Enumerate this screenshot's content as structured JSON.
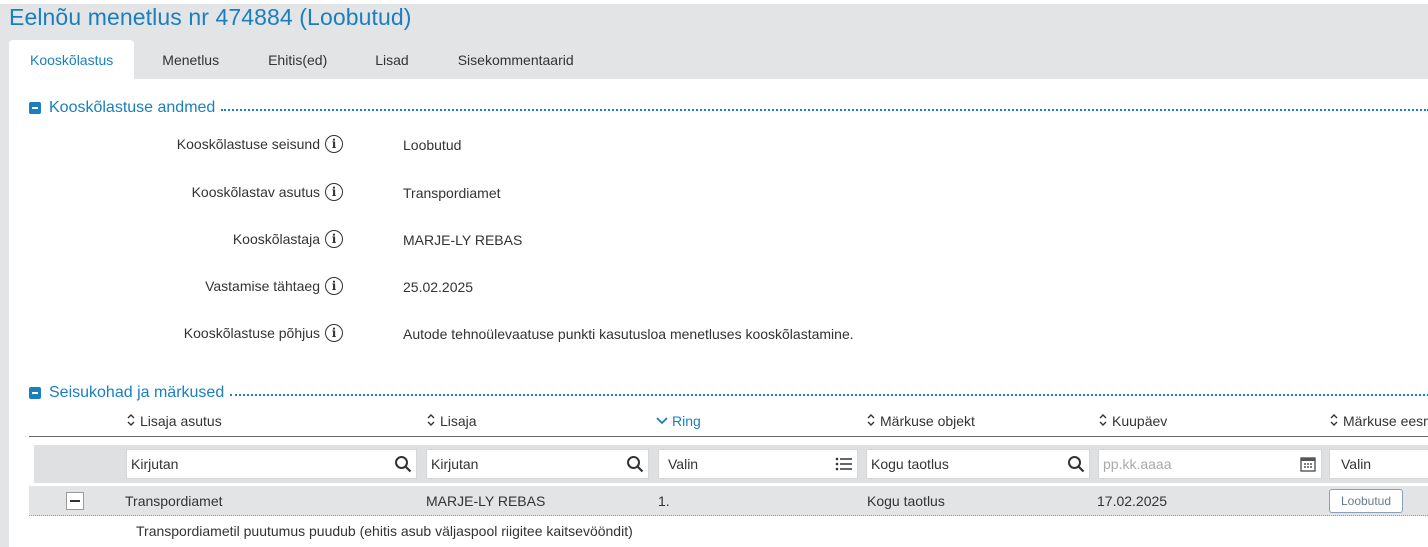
{
  "page_title": "Eelnõu menetlus nr 474884 (Loobutud)",
  "tabs": [
    {
      "label": "Kooskõlastus",
      "active": true
    },
    {
      "label": "Menetlus"
    },
    {
      "label": "Ehitis(ed)"
    },
    {
      "label": "Lisad"
    },
    {
      "label": "Sisekommentaarid"
    }
  ],
  "section1": {
    "title": "Kooskõlastuse andmed",
    "fields": [
      {
        "label": "Kooskõlastuse seisund",
        "value": "Loobutud"
      },
      {
        "label": "Kooskõlastav asutus",
        "value": "Transpordiamet"
      },
      {
        "label": "Kooskõlastaja",
        "value": "MARJE-LY REBAS"
      },
      {
        "label": "Vastamise tähtaeg",
        "value": "25.02.2025"
      },
      {
        "label": "Kooskõlastuse põhjus",
        "value": "Autode tehnoülevaatuse punkti kasutusloa menetluses kooskõlastamine."
      }
    ]
  },
  "section2": {
    "title": "Seisukohad ja märkused",
    "columns": [
      {
        "label": "Lisaja asutus"
      },
      {
        "label": "Lisaja"
      },
      {
        "label": "Ring",
        "sorted": "desc"
      },
      {
        "label": "Märkuse objekt"
      },
      {
        "label": "Kuupäev"
      },
      {
        "label": "Märkuse eesm"
      }
    ],
    "filters": [
      {
        "placeholder": "Kirjutan",
        "icon": "search-icon"
      },
      {
        "placeholder": "Kirjutan",
        "icon": "search-icon"
      },
      {
        "placeholder": "Valin",
        "icon": "list-icon"
      },
      {
        "value": "Kogu taotlus",
        "icon": "search-icon"
      },
      {
        "placeholder": "pp.kk.aaaa",
        "icon": "calendar-icon"
      },
      {
        "placeholder": "Valin",
        "icon": ""
      }
    ],
    "rows": [
      {
        "asutus": "Transpordiamet",
        "lisaja": "MARJE-LY REBAS",
        "ring": "1.",
        "objekt": "Kogu taotlus",
        "kuupaev": "17.02.2025",
        "eesmark": "Loobutud",
        "comment": "Transpordiametil puutumus puudub (ehitis asub väljaspool riigitee kaitsevööndit)"
      }
    ]
  },
  "colors": {
    "accent": "#1a7fbf",
    "background": "#e3e4e6",
    "panel": "#ffffff"
  }
}
